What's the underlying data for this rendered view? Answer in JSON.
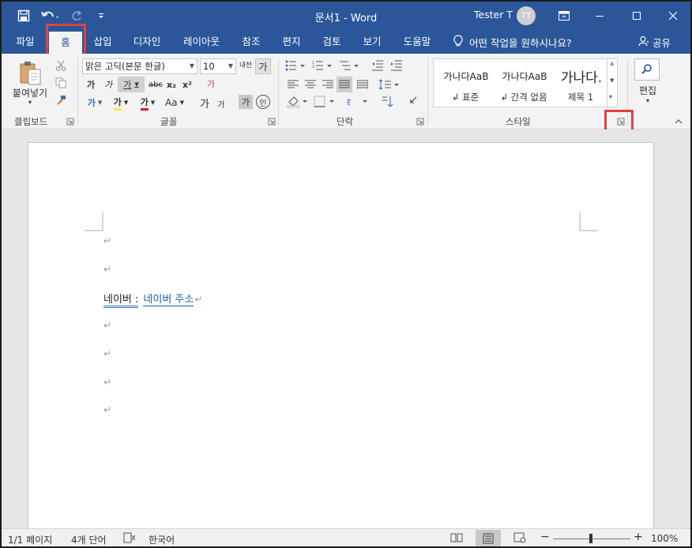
{
  "window": {
    "title": "문서1  -  Word",
    "user_name": "Tester T",
    "user_initials": "TT"
  },
  "tabs": [
    {
      "label": "파일"
    },
    {
      "label": "홈"
    },
    {
      "label": "삽입"
    },
    {
      "label": "디자인"
    },
    {
      "label": "레이아웃"
    },
    {
      "label": "참조"
    },
    {
      "label": "편지"
    },
    {
      "label": "검토"
    },
    {
      "label": "보기"
    },
    {
      "label": "도움말"
    }
  ],
  "tell_me": "어떤 작업을 원하시나요?",
  "share": "공유",
  "ribbon": {
    "clipboard": {
      "label": "클립보드",
      "paste": "붙여넣기"
    },
    "font": {
      "label": "글꼴",
      "font_name": "맑은 고딕(본문 한글)",
      "font_size": "10",
      "bold": "가",
      "italic": "가",
      "underline": "가",
      "strike": "abc",
      "subscript": "x₂",
      "superscript": "x²",
      "grow": "가",
      "shrink": "가",
      "case": "Aa",
      "highlight": "가",
      "font_color": "가",
      "char_shade": "가",
      "enclose": "가",
      "phonetic": "내천",
      "clear_format": "가",
      "text_effects": "가"
    },
    "paragraph": {
      "label": "단락"
    },
    "styles": {
      "label": "스타일",
      "items": [
        {
          "preview": "가나다AaB",
          "name": "↲ 표준"
        },
        {
          "preview": "가나다AaB",
          "name": "↲ 간격 없음"
        },
        {
          "preview": "가나다.",
          "name": "제목 1"
        }
      ]
    },
    "editing": {
      "label": "편집"
    }
  },
  "document": {
    "paragraph_mark": "↵",
    "text_before": "네이버 :",
    "text_link": "네이버 주소"
  },
  "status": {
    "page": "1/1 페이지",
    "words": "4개 단어",
    "language": "한국어",
    "zoom": "100%",
    "zoom_minus": "−",
    "zoom_plus": "+"
  },
  "colors": {
    "accent": "#2b579a",
    "highlight_box": "#e34040",
    "link": "#1f5fa8"
  }
}
